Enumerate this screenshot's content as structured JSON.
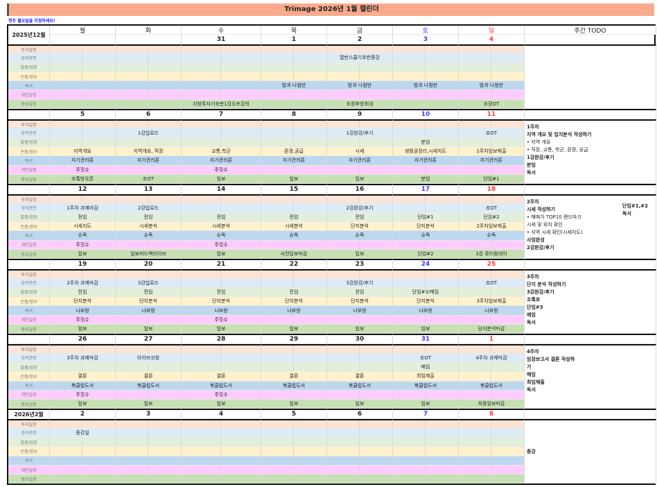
{
  "title": "Trimage 2026년 1월 캘린더",
  "hint": "첫주 월요일을 지정하세요!",
  "colors": {
    "title_bg": "#fbab8d",
    "saturday": "#3a3aff",
    "sunday": "#ff3b3b",
    "categories": [
      "#fce4d6",
      "#ddebf7",
      "#e2efda",
      "#fff2cc",
      "#bdd7ee",
      "#ffccff",
      "#c6e0b4"
    ]
  },
  "weekdays": [
    "월",
    "화",
    "수",
    "목",
    "금",
    "토",
    "일"
  ],
  "todo_header": "주간 TODO",
  "categories": [
    "투자일정",
    "강의관련",
    "발품/임장",
    "손품/정보",
    "독서",
    "개인일정",
    "중요일정"
  ],
  "weeks": [
    {
      "month": "2025년12월",
      "dates": [
        "",
        "",
        "31",
        "1",
        "2",
        "3",
        "4"
      ],
      "cells": [
        [
          "",
          "",
          "",
          "",
          "",
          "",
          ""
        ],
        [
          "",
          "",
          "",
          "",
          "열반스쿨기초반종강",
          "",
          ""
        ],
        [
          "",
          "",
          "",
          "",
          "",
          "",
          ""
        ],
        [
          "",
          "",
          "",
          "",
          "",
          "",
          ""
        ],
        [
          "",
          "",
          "",
          "밤과 나침반",
          "밤과 나침반",
          "밤과 나침반",
          "밤과 나침반"
        ],
        [
          "",
          "",
          "",
          "",
          "",
          "",
          ""
        ],
        [
          "",
          "",
          "지방투자기초반1강오프강의",
          "",
          "조장후방초대",
          "",
          "조장OT"
        ]
      ],
      "todo": [],
      "todo_extra": []
    },
    {
      "month": "",
      "dates": [
        "5",
        "6",
        "7",
        "8",
        "9",
        "10",
        "11"
      ],
      "cells": [
        [
          "",
          "",
          "",
          "",
          "",
          "",
          ""
        ],
        [
          "",
          "1강업로드",
          "",
          "",
          "1강완강/후기",
          "",
          "조OT"
        ],
        [
          "",
          "",
          "",
          "",
          "",
          "분임",
          ""
        ],
        [
          "지역개요",
          "지역개요, 직장",
          "교통,학군",
          "환경,공급",
          "시세",
          "생활권정리,시세지도",
          "1주차임보제출"
        ],
        [
          "자기관리론",
          "자기관리론",
          "자기관리론",
          "자기관리론",
          "자기관리론",
          "자기관리론",
          "자기관리론"
        ],
        [
          "주짓수",
          "",
          "주짓수",
          "",
          "",
          "",
          ""
        ],
        [
          "조톡방오픈",
          "조OT",
          "임보",
          "임보",
          "임보",
          "분임",
          "단임#1"
        ]
      ],
      "todo": [
        "1주차",
        "지역 개요 및 입지분석 작성하기",
        "• 지역 개요",
        "• 직장, 교통, 학군, 환경, 공급",
        "1강완강/후기",
        "분임",
        "독서"
      ],
      "todo_extra": []
    },
    {
      "month": "",
      "dates": [
        "12",
        "13",
        "14",
        "15",
        "16",
        "17",
        "18"
      ],
      "cells": [
        [
          "",
          "",
          "",
          "",
          "",
          "",
          ""
        ],
        [
          "1주차 과제마감",
          "2강업로드",
          "",
          "",
          "2강완강/후기",
          "",
          "조OT"
        ],
        [
          "전임",
          "전임",
          "전임",
          "전임",
          "전임",
          "단임#1",
          "단임#2"
        ],
        [
          "시세지도",
          "시세분석",
          "시세분석",
          "시세분석",
          "단지분석",
          "단지분석",
          "2주차임보제출"
        ],
        [
          "슈독",
          "슈독",
          "슈독",
          "슈독",
          "슈독",
          "슈독",
          "슈독"
        ],
        [
          "주짓수",
          "",
          "주짓수",
          "",
          "",
          "",
          ""
        ],
        [
          "임보",
          "임보피드백라이브",
          "임보",
          "사전임보마감",
          "임보",
          "단임#2",
          "3강 튜터링데이"
        ]
      ],
      "todo": [
        "2주차",
        "시세 작성하기",
        "• 매매가 TOP10 랜드마크",
        "시세 및 위치 확인",
        "• 지역 시세 확인(시세지도)",
        "사임완성",
        "2강완강/후기"
      ],
      "todo_extra": [
        "단임#1,#2",
        "독서"
      ]
    },
    {
      "month": "",
      "dates": [
        "19",
        "20",
        "21",
        "22",
        "23",
        "24",
        "25"
      ],
      "cells": [
        [
          "",
          "",
          "",
          "",
          "",
          "",
          ""
        ],
        [
          "2주차 과제마감",
          "3강업로드",
          "",
          "",
          "3강완강/후기",
          "",
          "조OT"
        ],
        [
          "전임",
          "전임",
          "전임",
          "전임",
          "전임",
          "단임#3/매임",
          ""
        ],
        [
          "단지분석",
          "단지분석",
          "단지분석",
          "단지분석",
          "단지분석",
          "단지분석",
          "3주차임보제출"
        ],
        [
          "나부랑",
          "나부랑",
          "나부랑",
          "나부랑",
          "나부랑",
          "나부랑",
          "나부랑"
        ],
        [
          "주짓수",
          "",
          "주짓수",
          "",
          "",
          "",
          ""
        ],
        [
          "임보",
          "임보",
          "임보",
          "임보",
          "임보",
          "임보",
          "단지분석마감"
        ]
      ],
      "todo": [
        "3주차",
        "단지 분석 작성하기",
        "3강완강/후기",
        "조톡포",
        "단임#3",
        "매임",
        "독서"
      ],
      "todo_extra": []
    },
    {
      "month": "",
      "dates": [
        "26",
        "27",
        "28",
        "29",
        "30",
        "31",
        "1"
      ],
      "cells": [
        [
          "",
          "",
          "",
          "",
          "",
          "",
          ""
        ],
        [
          "3주차 과제마감",
          "라이브코칭",
          "",
          "",
          "",
          "조OT",
          "4주차 과제마감"
        ],
        [
          "",
          "",
          "",
          "",
          "",
          "매임",
          ""
        ],
        [
          "결론",
          "결론",
          "결론",
          "결론",
          "결론",
          "최임제출",
          ""
        ],
        [
          "북클럽도서",
          "북클럽도서",
          "북클럽도서",
          "북클럽도서",
          "북클럽도서",
          "북클럽도서",
          "북클럽도서"
        ],
        [
          "주짓수",
          "",
          "주짓수",
          "",
          "",
          "",
          ""
        ],
        [
          "임보",
          "임보",
          "임보",
          "임보",
          "임보",
          "임보",
          "최종임보마감"
        ]
      ],
      "todo": [
        "4주차",
        "임장보고서 결론 작성하",
        "기",
        "매임",
        "최임제출",
        "독서"
      ],
      "todo_extra": []
    },
    {
      "month": "2026년2월",
      "dates": [
        "2",
        "3",
        "4",
        "5",
        "6",
        "7",
        "8"
      ],
      "cells": [
        [
          "",
          "",
          "",
          "",
          "",
          "",
          ""
        ],
        [
          "종강일",
          "",
          "",
          "",
          "",
          "",
          ""
        ],
        [
          "",
          "",
          "",
          "",
          "",
          "",
          ""
        ],
        [
          "",
          "",
          "",
          "",
          "",
          "",
          ""
        ],
        [
          "",
          "",
          "",
          "",
          "",
          "",
          ""
        ],
        [
          "",
          "",
          "",
          "",
          "",
          "",
          ""
        ],
        [
          "",
          "",
          "",
          "",
          "",
          "",
          ""
        ]
      ],
      "todo": [
        "종강"
      ],
      "todo_extra": []
    }
  ]
}
